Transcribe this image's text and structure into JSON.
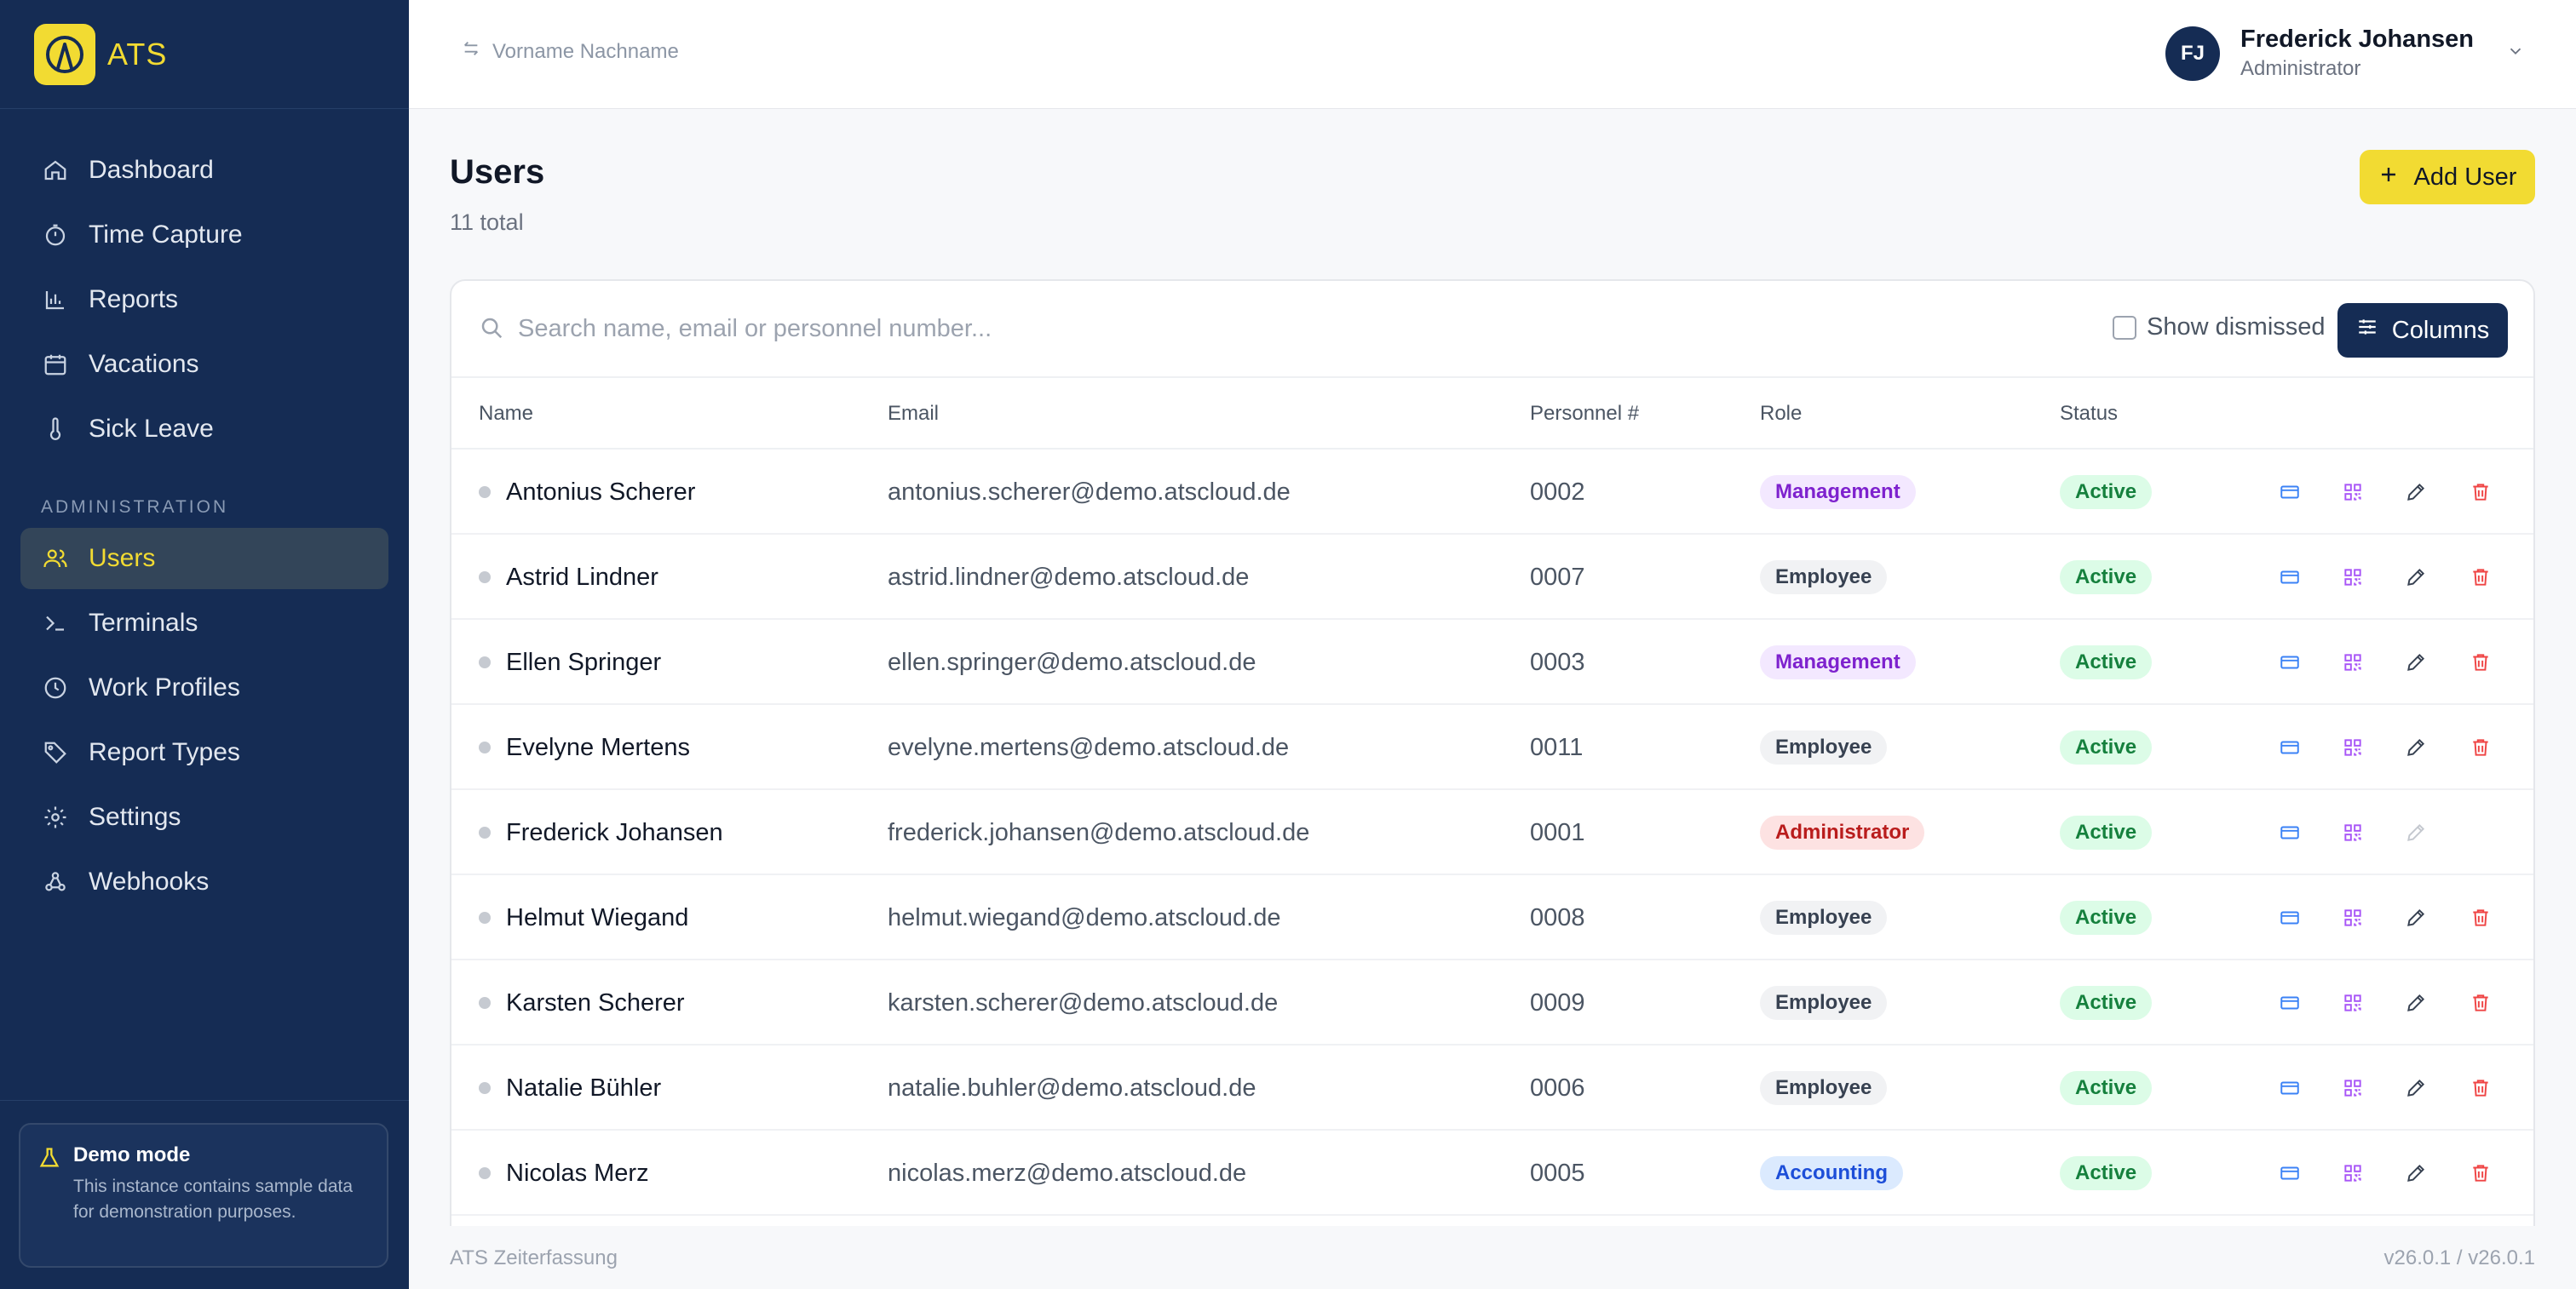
{
  "brand": {
    "name": "ATS"
  },
  "nav": {
    "items": [
      {
        "label": "Dashboard",
        "icon": "home-icon"
      },
      {
        "label": "Time Capture",
        "icon": "stopwatch-icon"
      },
      {
        "label": "Reports",
        "icon": "bar-chart-icon"
      },
      {
        "label": "Vacations",
        "icon": "calendar-icon"
      },
      {
        "label": "Sick Leave",
        "icon": "thermometer-icon"
      }
    ],
    "section_label": "ADMINISTRATION",
    "admin_items": [
      {
        "label": "Users",
        "icon": "users-icon",
        "active": true
      },
      {
        "label": "Terminals",
        "icon": "terminal-icon"
      },
      {
        "label": "Work Profiles",
        "icon": "clock-icon"
      },
      {
        "label": "Report Types",
        "icon": "tag-icon"
      },
      {
        "label": "Settings",
        "icon": "gear-icon"
      },
      {
        "label": "Webhooks",
        "icon": "webhook-icon"
      }
    ]
  },
  "demo": {
    "title": "Demo mode",
    "text": "This instance contains sample data for demonstration purposes."
  },
  "header": {
    "switcher_placeholder": "Vorname Nachname",
    "user_name": "Frederick Johansen",
    "user_role": "Administrator",
    "user_initials": "FJ"
  },
  "page": {
    "title": "Users",
    "count": "11 total",
    "add_button": "Add User"
  },
  "toolbar": {
    "search_placeholder": "Search name, email or personnel number...",
    "show_dismissed": "Show dismissed",
    "columns_button": "Columns"
  },
  "table": {
    "headers": {
      "name": "Name",
      "email": "Email",
      "personnel": "Personnel #",
      "role": "Role",
      "status": "Status"
    },
    "rows": [
      {
        "name": "Antonius Scherer",
        "email": "antonius.scherer@demo.atscloud.de",
        "personnel": "0002",
        "role": "Management",
        "status": "Active",
        "deletable": true
      },
      {
        "name": "Astrid Lindner",
        "email": "astrid.lindner@demo.atscloud.de",
        "personnel": "0007",
        "role": "Employee",
        "status": "Active",
        "deletable": true
      },
      {
        "name": "Ellen Springer",
        "email": "ellen.springer@demo.atscloud.de",
        "personnel": "0003",
        "role": "Management",
        "status": "Active",
        "deletable": true
      },
      {
        "name": "Evelyne Mertens",
        "email": "evelyne.mertens@demo.atscloud.de",
        "personnel": "0011",
        "role": "Employee",
        "status": "Active",
        "deletable": true
      },
      {
        "name": "Frederick Johansen",
        "email": "frederick.johansen@demo.atscloud.de",
        "personnel": "0001",
        "role": "Administrator",
        "status": "Active",
        "deletable": false
      },
      {
        "name": "Helmut Wiegand",
        "email": "helmut.wiegand@demo.atscloud.de",
        "personnel": "0008",
        "role": "Employee",
        "status": "Active",
        "deletable": true
      },
      {
        "name": "Karsten Scherer",
        "email": "karsten.scherer@demo.atscloud.de",
        "personnel": "0009",
        "role": "Employee",
        "status": "Active",
        "deletable": true
      },
      {
        "name": "Natalie Bühler",
        "email": "natalie.buhler@demo.atscloud.de",
        "personnel": "0006",
        "role": "Employee",
        "status": "Active",
        "deletable": true
      },
      {
        "name": "Nicolas Merz",
        "email": "nicolas.merz@demo.atscloud.de",
        "personnel": "0005",
        "role": "Accounting",
        "status": "Active",
        "deletable": true
      }
    ]
  },
  "footer": {
    "left": "ATS Zeiterfassung",
    "right": "v26.0.1 / v26.0.1"
  },
  "colors": {
    "sidebar": "#152c54",
    "accent": "#f2db32",
    "danger": "#ef4444",
    "info": "#3b82f6",
    "purple": "#a855f7"
  }
}
